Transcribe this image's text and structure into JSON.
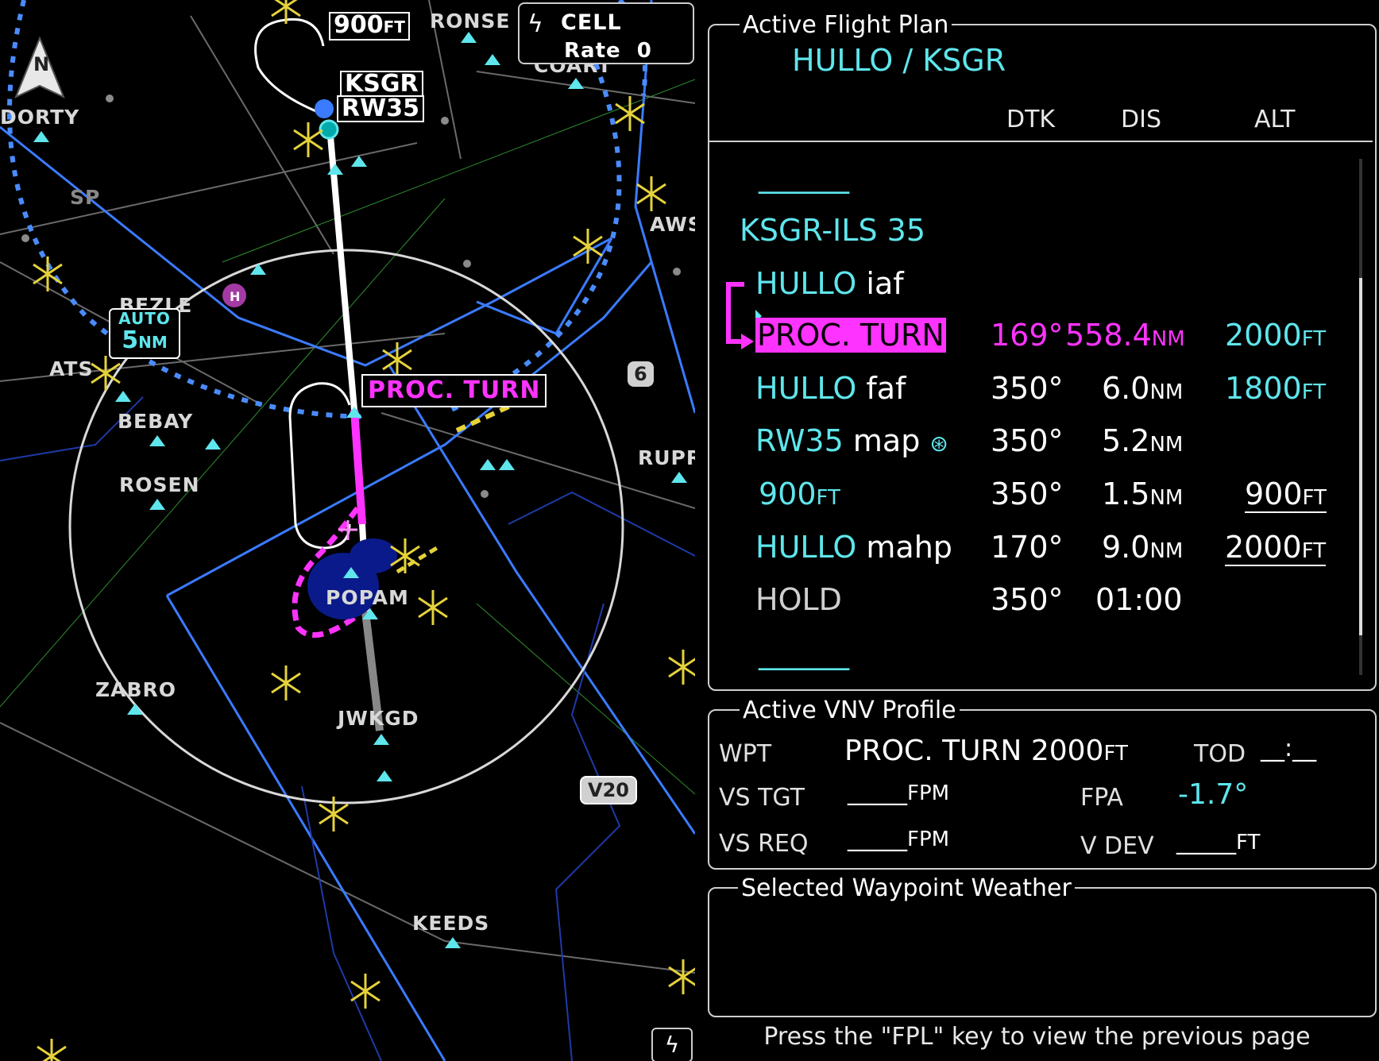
{
  "map": {
    "north_label": "N",
    "cell_label": "CELL",
    "rate_label": "Rate",
    "rate_value": "0",
    "range_mode": "AUTO",
    "range_value": "5",
    "range_unit": "NM",
    "altitude_tag": {
      "value": "900",
      "unit": "FT"
    },
    "airport_tag": "KSGR",
    "runway_tag": "RW35",
    "active_leg_tag": "PROC. TURN",
    "shield_6": "6",
    "airway_v20": "V20",
    "waypoints": [
      "RONSE",
      "COART",
      "DORTY",
      "BEZLE",
      "ATS",
      "BEBAY",
      "ROSEN",
      "AWS",
      "RUPR",
      "POPAM",
      "ZABRO",
      "JWKGD",
      "KEEDS",
      "SP"
    ],
    "heliport": "H"
  },
  "flight_plan": {
    "title": "Active Flight Plan",
    "route": "HULLO / KSGR",
    "headers": {
      "dtk": "DTK",
      "dis": "DIS",
      "alt": "ALT"
    },
    "dashes_top": "______",
    "procedure": "KSGR-ILS 35",
    "rows": [
      {
        "name": "HULLO",
        "suffix": "iaf",
        "dtk": "",
        "dis": "",
        "dis_unit": "",
        "alt": "",
        "alt_unit": ""
      },
      {
        "name": "PROC. TURN",
        "suffix": "",
        "dtk": "169°",
        "dis": "558.4",
        "dis_unit": "NM",
        "alt": "2000",
        "alt_unit": "FT"
      },
      {
        "name": "HULLO",
        "suffix": "faf",
        "dtk": "350°",
        "dis": "6.0",
        "dis_unit": "NM",
        "alt": "1800",
        "alt_unit": "FT"
      },
      {
        "name": "RW35",
        "suffix": "map",
        "dtk": "350°",
        "dis": "5.2",
        "dis_unit": "NM",
        "alt": "",
        "alt_unit": ""
      },
      {
        "name": "900",
        "name_unit": "FT",
        "suffix": "",
        "dtk": "350°",
        "dis": "1.5",
        "dis_unit": "NM",
        "alt": "900",
        "alt_unit": "FT"
      },
      {
        "name": "HULLO",
        "suffix": "mahp",
        "dtk": "170°",
        "dis": "9.0",
        "dis_unit": "NM",
        "alt": "2000",
        "alt_unit": "FT"
      },
      {
        "name": "HOLD",
        "suffix": "",
        "dtk": "350°",
        "dis": "01:00",
        "dis_unit": "",
        "alt": "",
        "alt_unit": ""
      }
    ],
    "dashes_bottom": "______"
  },
  "vnv": {
    "title": "Active VNV Profile",
    "wpt_label": "WPT",
    "wpt_value": "PROC. TURN",
    "wpt_alt": "2000",
    "wpt_alt_unit": "FT",
    "tod_label": "TOD",
    "tod_value": "__:__",
    "vs_tgt_label": "VS TGT",
    "vs_tgt_value": "_____",
    "vs_tgt_unit": "FPM",
    "fpa_label": "FPA",
    "fpa_value": "-1.7°",
    "vs_req_label": "VS REQ",
    "vs_req_value": "_____",
    "vs_req_unit": "FPM",
    "vdev_label": "V DEV",
    "vdev_value": "_____",
    "vdev_unit": "FT"
  },
  "weather": {
    "title": "Selected Waypoint Weather"
  },
  "footer": "Press the \"FPL\" key to view the previous page",
  "colors": {
    "cyan": "#5ee6ec",
    "magenta": "#ff33ff",
    "airspace_blue": "#3b7bff",
    "white": "#ffffff"
  }
}
